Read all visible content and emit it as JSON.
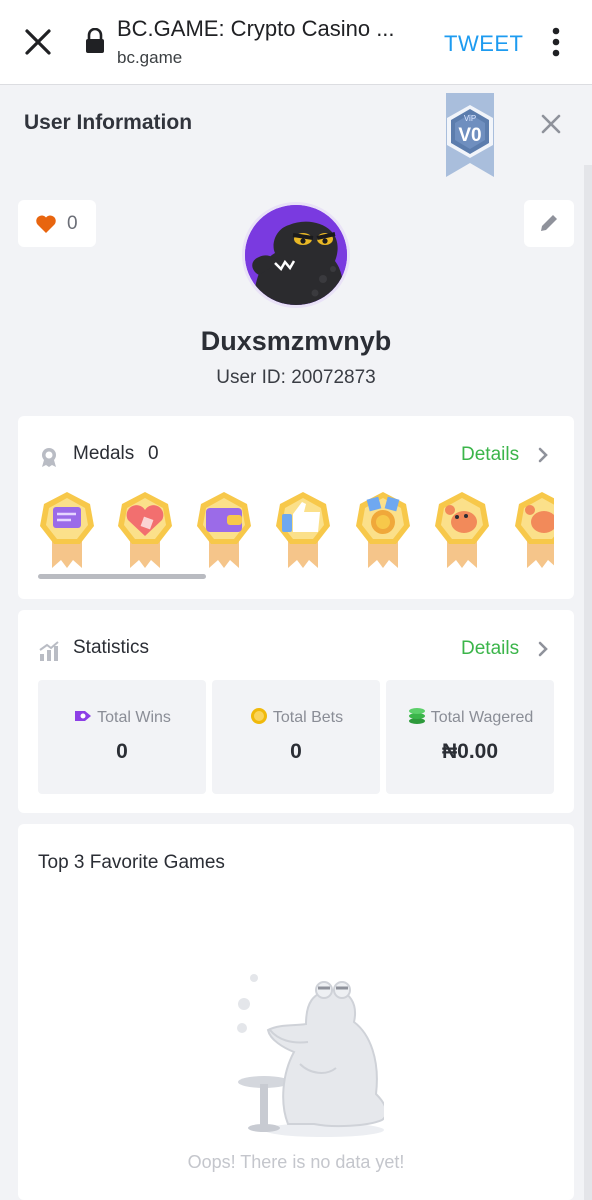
{
  "browser": {
    "title": "BC.GAME: Crypto Casino ...",
    "url": "bc.game",
    "tweet_label": "TWEET"
  },
  "header": {
    "title": "User Information",
    "vip_small": "ViP",
    "vip_level": "V0"
  },
  "profile": {
    "likes": "0",
    "username": "Duxsmzmvnyb",
    "user_id": "User ID: 20072873"
  },
  "medals": {
    "title": "Medals",
    "count": "0",
    "details_label": "Details",
    "items": [
      {
        "icon": "chat-medal-icon"
      },
      {
        "icon": "heart-medal-icon"
      },
      {
        "icon": "wallet-medal-icon"
      },
      {
        "icon": "thumbs-up-medal-icon"
      },
      {
        "icon": "coin-medal-icon"
      },
      {
        "icon": "crab-medal-icon"
      },
      {
        "icon": "crab-medal-icon"
      }
    ]
  },
  "statistics": {
    "title": "Statistics",
    "details_label": "Details",
    "items": [
      {
        "label": "Total Wins",
        "value": "0",
        "icon": "ticket-icon",
        "color": "#8d3fe6"
      },
      {
        "label": "Total Bets",
        "value": "0",
        "icon": "coin-icon",
        "color": "#f0b90b"
      },
      {
        "label": "Total Wagered",
        "value": "₦0.00",
        "icon": "stack-icon",
        "color": "#3bb54a"
      }
    ]
  },
  "favorites": {
    "title": "Top 3 Favorite Games",
    "empty_text": "Oops! There is no data yet!"
  },
  "colors": {
    "accent_green": "#3bb54a",
    "tweet_blue": "#1d9bf0",
    "heart": "#e8650f",
    "avatar_bg": "#7a3ae0"
  }
}
